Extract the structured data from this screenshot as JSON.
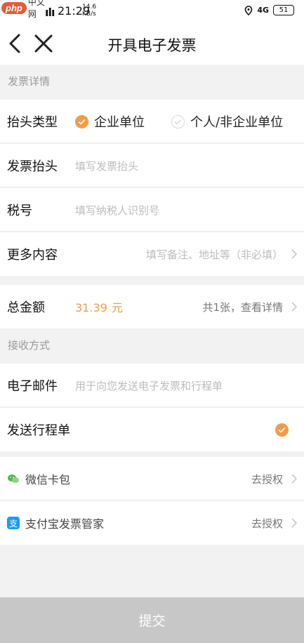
{
  "status_bar": {
    "logo_php": "php",
    "logo_cn": "中文网",
    "signal": "ılı",
    "time": "21:29",
    "net_speed_value": "14.6",
    "net_speed_unit": "KB/s",
    "network": "4G",
    "battery": "51"
  },
  "header": {
    "title": "开具电子发票",
    "back_icon": "chevron-left-icon",
    "close_icon": "close-icon"
  },
  "invoice_section": {
    "header": "发票详情",
    "title_type": {
      "label": "抬头类型",
      "options": [
        {
          "label": "企业单位",
          "selected": true
        },
        {
          "label": "个人/非企业单位",
          "selected": false
        }
      ]
    },
    "invoice_title": {
      "label": "发票抬头",
      "placeholder": "填写发票抬头"
    },
    "tax_number": {
      "label": "税号",
      "placeholder": "填写纳税人识别号"
    },
    "more": {
      "label": "更多内容",
      "placeholder": "填写备注、地址等（非必填）"
    }
  },
  "total": {
    "label": "总金额",
    "amount": "31.39",
    "unit": "元",
    "detail": "共1张，查看详情"
  },
  "receive_section": {
    "header": "接收方式",
    "email": {
      "label": "电子邮件",
      "placeholder": "用于向您发送电子发票和行程单"
    },
    "send_itinerary": {
      "label": "发送行程单",
      "checked": true
    }
  },
  "services": [
    {
      "label": "微信卡包",
      "action": "去授权",
      "icon": "wechat-icon"
    },
    {
      "label": "支付宝发票管家",
      "action": "去授权",
      "icon": "alipay-icon",
      "icon_glyph": "支"
    }
  ],
  "submit_label": "提交",
  "colors": {
    "accent": "#f39b46",
    "background": "#f2f2f2",
    "submit_disabled": "#c7c7c7"
  }
}
